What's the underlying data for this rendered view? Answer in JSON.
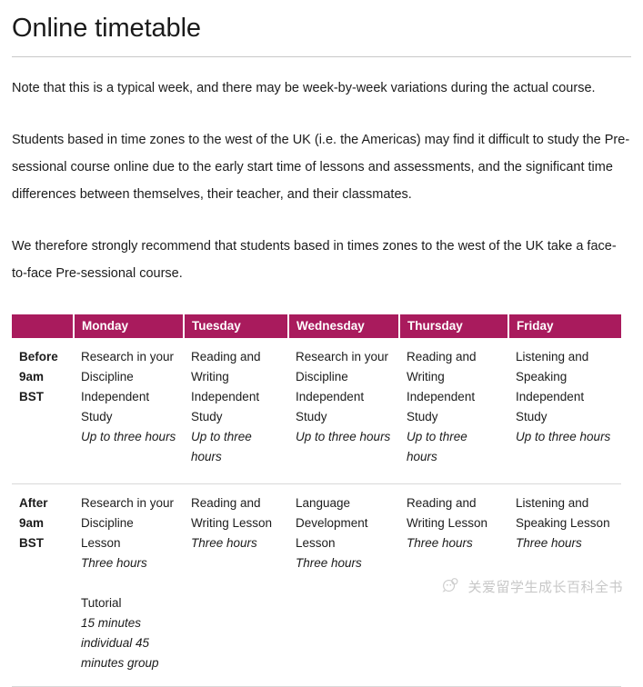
{
  "page": {
    "title": "Online timetable",
    "paragraphs": [
      "Note that this is a typical week, and there may be week-by-week variations during the actual course.",
      "Students based in time zones to the west of the UK (i.e. the Americas) may find it difficult to study the Pre-sessional course online due to the early start time of lessons and assessments, and the significant time differences between themselves, their teacher, and their classmates.",
      "We therefore strongly recommend that students based in times zones to the west of the UK take a face-to-face Pre-sessional course."
    ]
  },
  "theme": {
    "header_bg": "#a91b5d",
    "header_text": "#ffffff",
    "body_text": "#1c1c1c",
    "rule": "#d9d9d9"
  },
  "timetable": {
    "columns": [
      "",
      "Monday",
      "Tuesday",
      "Wednesday",
      "Thursday",
      "Friday"
    ],
    "rows": [
      {
        "label": [
          "Before",
          "9am",
          "BST"
        ],
        "cells": [
          {
            "blocks": [
              {
                "lines": [
                  "Research in your",
                  "Discipline",
                  "Independent Study"
                ],
                "duration": "Up to three hours"
              }
            ]
          },
          {
            "blocks": [
              {
                "lines": [
                  "Reading and",
                  "Writing",
                  "Independent",
                  "Study"
                ],
                "duration": "Up to three hours"
              }
            ]
          },
          {
            "blocks": [
              {
                "lines": [
                  "Research in your",
                  "Discipline",
                  "Independent Study"
                ],
                "duration": "Up to three hours"
              }
            ]
          },
          {
            "blocks": [
              {
                "lines": [
                  "Reading and",
                  "Writing",
                  "Independent",
                  "Study"
                ],
                "duration": "Up to three hours"
              }
            ]
          },
          {
            "blocks": [
              {
                "lines": [
                  "Listening and",
                  "Speaking",
                  "Independent",
                  "Study"
                ],
                "duration": "Up to three hours"
              }
            ]
          }
        ]
      },
      {
        "label": [
          "After",
          "9am",
          "BST"
        ],
        "cells": [
          {
            "blocks": [
              {
                "lines": [
                  "Research in your",
                  "Discipline Lesson"
                ],
                "duration": "Three hours"
              },
              {
                "lines": [
                  "Tutorial"
                ],
                "duration": "15 minutes individual 45 minutes group"
              }
            ]
          },
          {
            "blocks": [
              {
                "lines": [
                  "Reading and",
                  "Writing Lesson"
                ],
                "duration": "Three hours"
              }
            ]
          },
          {
            "blocks": [
              {
                "lines": [
                  "Language",
                  "Development",
                  "Lesson"
                ],
                "duration": "Three hours"
              }
            ]
          },
          {
            "blocks": [
              {
                "lines": [
                  "Reading and",
                  "Writing Lesson"
                ],
                "duration": "Three hours"
              }
            ]
          },
          {
            "blocks": [
              {
                "lines": [
                  "Listening and",
                  "Speaking Lesson"
                ],
                "duration": "Three hours"
              }
            ]
          }
        ]
      }
    ]
  },
  "watermark": {
    "text": "关爱留学生成长百科全书",
    "icon": "speech-bubble-logo"
  }
}
